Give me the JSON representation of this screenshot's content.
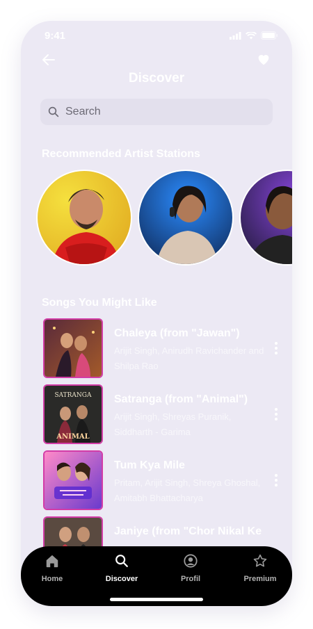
{
  "status": {
    "time": "9:41"
  },
  "header": {
    "title": "Discover"
  },
  "search": {
    "placeholder": "Search"
  },
  "sections": {
    "artists_title": "Recommended Artist Stations",
    "songs_title": "Songs You Might Like"
  },
  "artists": [
    {
      "colors": [
        "#f4d23a",
        "#d81e1e"
      ]
    },
    {
      "colors": [
        "#1e6fd9",
        "#0b1b3f"
      ]
    },
    {
      "colors": [
        "#6a2fd0",
        "#1b1830"
      ]
    }
  ],
  "songs": [
    {
      "title": "Chaleya (from \"Jawan\")",
      "artists": "Arijit Singh, Anirudh Ravichander and Shilpa Rao"
    },
    {
      "title": "Satranga (from \"Animal\")",
      "artists": "Arijit Singh, Shreyas Puranik, Siddharth - Garima"
    },
    {
      "title": "Tum Kya Mile",
      "artists": "Pritam, Arijit Singh, Shreya Ghoshal, Amitabh Bhattacharya"
    },
    {
      "title": "Janiye (from \"Chor Nikal Ke",
      "artists": ""
    }
  ],
  "nav": [
    {
      "label": "Home",
      "icon": "home-icon"
    },
    {
      "label": "Discover",
      "icon": "search-icon",
      "active": true
    },
    {
      "label": "Profil",
      "icon": "profile-icon"
    },
    {
      "label": "Premium",
      "icon": "star-icon"
    }
  ]
}
